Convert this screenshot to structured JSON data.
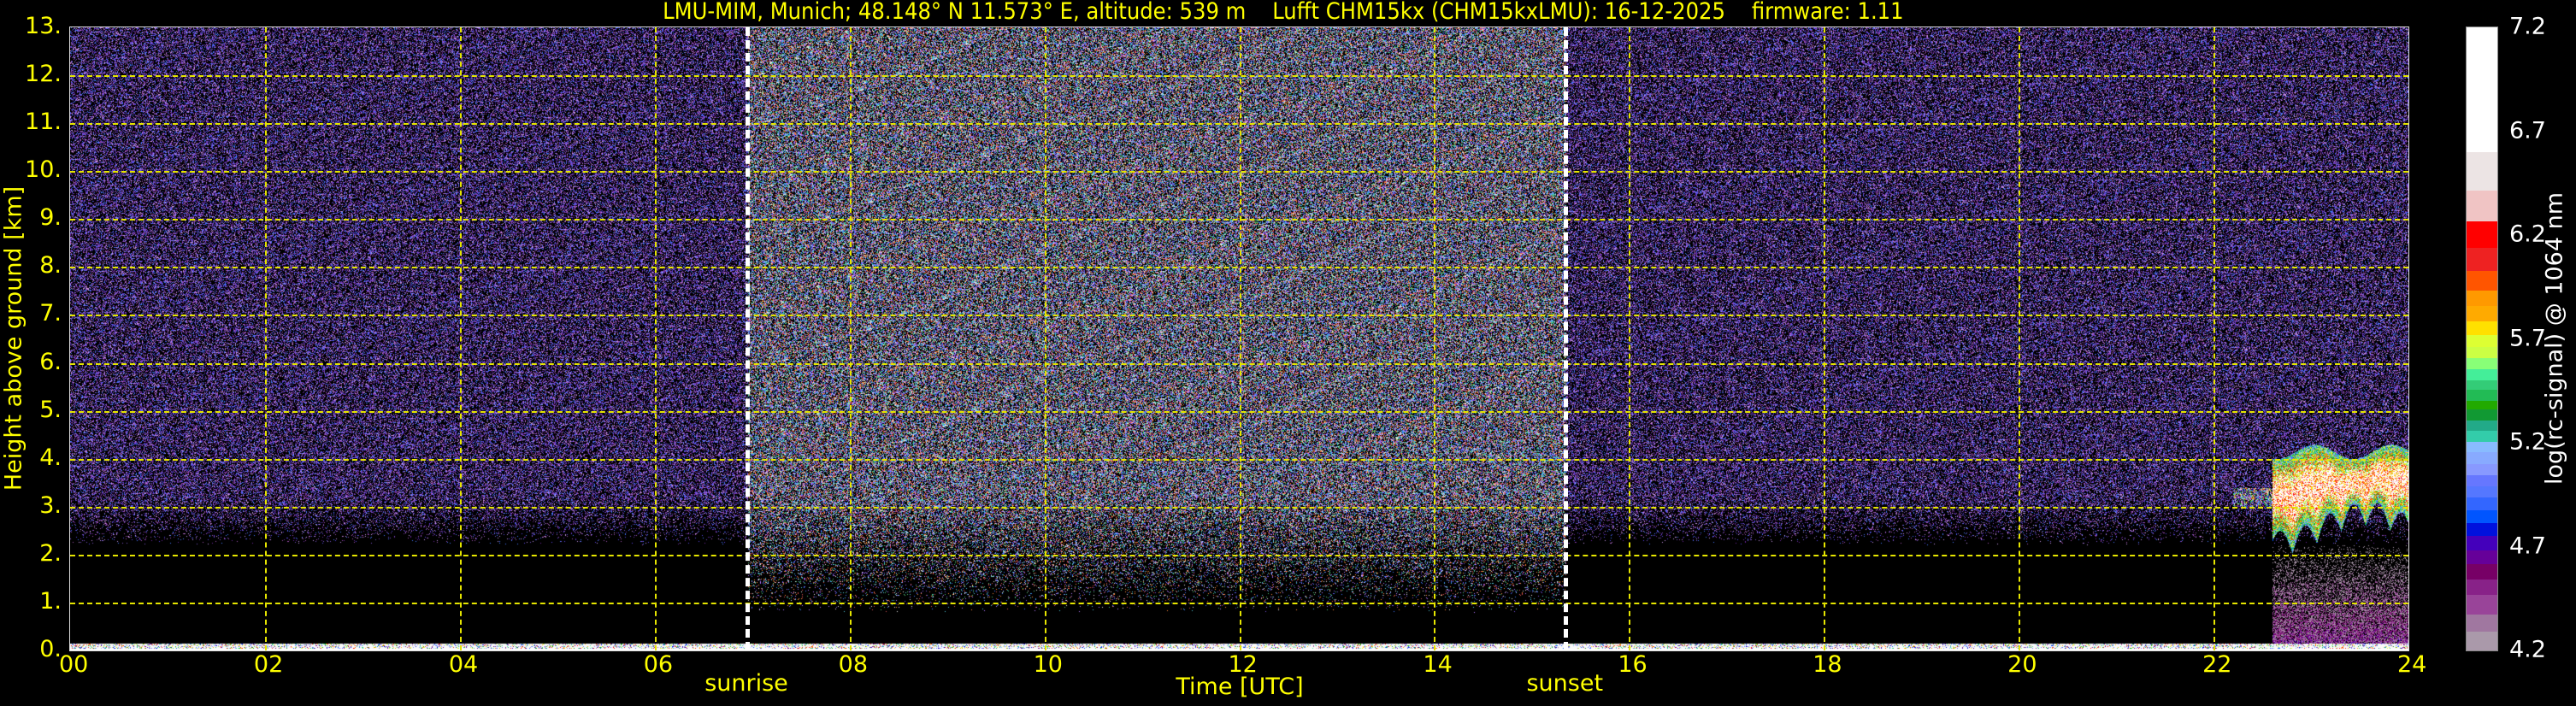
{
  "title": "LMU-MIM, Munich; 48.148° N 11.573° E, altitude: 539 m    Lufft CHM15kx (CHM15kxLMU): 16-12-2025    firmware: 1.11",
  "chart_data": {
    "type": "heatmap",
    "title": "LMU-MIM, Munich; 48.148° N 11.573° E, altitude: 539 m    Lufft CHM15kx (CHM15kxLMU): 16-12-2025    firmware: 1.11",
    "xlabel": "Time [UTC]",
    "ylabel": "Height above ground [km]",
    "xlim": [
      0,
      24
    ],
    "ylim": [
      0,
      13
    ],
    "grid": true,
    "x_ticks": [
      "00",
      "02",
      "04",
      "06",
      "08",
      "10",
      "12",
      "14",
      "16",
      "18",
      "20",
      "22",
      "24"
    ],
    "x_tick_values": [
      0,
      2,
      4,
      6,
      8,
      10,
      12,
      14,
      16,
      18,
      20,
      22,
      24
    ],
    "y_ticks": [
      "0.",
      "1.",
      "2.",
      "3.",
      "4.",
      "5.",
      "6.",
      "7.",
      "8.",
      "9.",
      "10.",
      "11.",
      "12.",
      "13."
    ],
    "y_tick_values": [
      0,
      1,
      2,
      3,
      4,
      5,
      6,
      7,
      8,
      9,
      10,
      11,
      12,
      13
    ],
    "annotations": [
      {
        "label": "sunrise",
        "time": 6.95
      },
      {
        "label": "sunset",
        "time": 15.35
      }
    ],
    "features": [
      {
        "name": "cloud layer",
        "time_range": [
          22.6,
          24
        ],
        "height_range_km": [
          2.3,
          4.3
        ]
      },
      {
        "name": "boundary layer aerosol",
        "time_range": [
          22.6,
          24
        ],
        "height_range_km": [
          0,
          2.2
        ]
      },
      {
        "name": "near-ground strong signal",
        "time_range": [
          0,
          24
        ],
        "height_range_km": [
          0,
          0.15
        ]
      }
    ],
    "colorbar": {
      "label": "log(rc-signal) @ 1064 nm",
      "range": [
        4.2,
        7.2
      ],
      "ticks": [
        "7.2",
        "6.7",
        "6.2",
        "5.7",
        "5.2",
        "4.7",
        "4.2"
      ],
      "tick_values": [
        7.2,
        6.7,
        6.2,
        5.7,
        5.2,
        4.7,
        4.2
      ],
      "bins": [
        {
          "from": 6.598,
          "to": 7.2,
          "color": "#ffffff"
        },
        {
          "from": 6.414,
          "to": 6.598,
          "color": "#ece4e4"
        },
        {
          "from": 6.264,
          "to": 6.414,
          "color": "#f0c4c4"
        },
        {
          "from": 6.139,
          "to": 6.264,
          "color": "#ff0000"
        },
        {
          "from": 6.026,
          "to": 6.139,
          "color": "#ee2222"
        },
        {
          "from": 5.933,
          "to": 6.026,
          "color": "#ff5500"
        },
        {
          "from": 5.857,
          "to": 5.933,
          "color": "#ff9900"
        },
        {
          "from": 5.786,
          "to": 5.857,
          "color": "#ffaa00"
        },
        {
          "from": 5.718,
          "to": 5.786,
          "color": "#ffe000"
        },
        {
          "from": 5.662,
          "to": 5.718,
          "color": "#ddff33"
        },
        {
          "from": 5.608,
          "to": 5.662,
          "color": "#ccff44"
        },
        {
          "from": 5.554,
          "to": 5.608,
          "color": "#88ff77"
        },
        {
          "from": 5.5,
          "to": 5.554,
          "color": "#44ee99"
        },
        {
          "from": 5.456,
          "to": 5.5,
          "color": "#33cc77"
        },
        {
          "from": 5.402,
          "to": 5.456,
          "color": "#22bb55"
        },
        {
          "from": 5.359,
          "to": 5.402,
          "color": "#22aa00"
        },
        {
          "from": 5.305,
          "to": 5.359,
          "color": "#119933"
        },
        {
          "from": 5.257,
          "to": 5.305,
          "color": "#22aa88"
        },
        {
          "from": 5.203,
          "to": 5.257,
          "color": "#33ccaa"
        },
        {
          "from": 5.153,
          "to": 5.203,
          "color": "#88bbff"
        },
        {
          "from": 5.099,
          "to": 5.153,
          "color": "#88aaff"
        },
        {
          "from": 5.045,
          "to": 5.099,
          "color": "#8899ff"
        },
        {
          "from": 4.991,
          "to": 5.045,
          "color": "#6677ff"
        },
        {
          "from": 4.936,
          "to": 4.991,
          "color": "#5577ff"
        },
        {
          "from": 4.876,
          "to": 4.936,
          "color": "#3366ff"
        },
        {
          "from": 4.813,
          "to": 4.876,
          "color": "#0055ff"
        },
        {
          "from": 4.752,
          "to": 4.813,
          "color": "#0011dd"
        },
        {
          "from": 4.683,
          "to": 4.752,
          "color": "#4400bb"
        },
        {
          "from": 4.616,
          "to": 4.683,
          "color": "#660099"
        },
        {
          "from": 4.54,
          "to": 4.616,
          "color": "#770066"
        },
        {
          "from": 4.466,
          "to": 4.54,
          "color": "#882288"
        },
        {
          "from": 4.373,
          "to": 4.466,
          "color": "#994499"
        },
        {
          "from": 4.291,
          "to": 4.373,
          "color": "#a077a0"
        },
        {
          "from": 4.2,
          "to": 4.291,
          "color": "#aa99aa"
        }
      ]
    }
  }
}
